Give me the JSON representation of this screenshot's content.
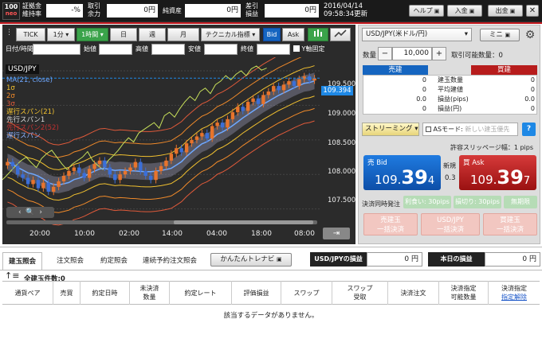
{
  "header": {
    "logo_top": "100",
    "logo_bottom": "neo",
    "margin_label_1": "証拠金",
    "margin_label_2": "維持率",
    "margin_value": "-%",
    "available_label_1": "取引",
    "available_label_2": "余力",
    "available_value": "0円",
    "net_assets_label": "純資産",
    "net_assets_value": "0円",
    "pnl_label_1": "差引",
    "pnl_label_2": "損益",
    "pnl_value": "0円",
    "date": "2016/04/14",
    "time_updated": "09:58:34更新",
    "help_label": "ヘルプ",
    "deposit_label": "入金",
    "withdraw_label": "出金"
  },
  "chart_toolbar": {
    "tick_label": "TICK",
    "interval_1m": "1分",
    "interval_1h": "1時間",
    "day_label": "日",
    "week_label": "週",
    "month_label": "月",
    "indicator_label": "テクニカル指標",
    "bid_label": "Bid",
    "ask_label": "Ask"
  },
  "ohlc": {
    "datetime_label": "日付/時間",
    "open_label": "始値",
    "high_label": "高値",
    "low_label": "安値",
    "close_label": "終値",
    "yfix_label": "Y軸固定"
  },
  "chart_data": {
    "type": "candlestick",
    "title": "USD/JPY",
    "legend": [
      "MA(21, close)",
      "1σ",
      "2σ",
      "3σ",
      "遅行スパン(21)",
      "先行スパン1",
      "先行スパン2(52)",
      "遅行スパン"
    ],
    "x_ticks": [
      "20:00",
      "10:00",
      "02:00",
      "14:00",
      "04:00",
      "18:00",
      "08:00"
    ],
    "y_ticks": [
      "109.500",
      "109.000",
      "108.500",
      "108.000",
      "107.500"
    ],
    "ylim": [
      107.3,
      109.65
    ],
    "current_price": "109.394",
    "closes": [
      108.18,
      108.12,
      108.0,
      107.95,
      107.86,
      107.92,
      107.8,
      107.88,
      107.75,
      107.82,
      107.9,
      107.98,
      108.05,
      108.1,
      108.02,
      107.95,
      108.08,
      108.15,
      108.2,
      108.1,
      108.0,
      107.92,
      108.0,
      108.05,
      108.1,
      108.18,
      108.05,
      107.98,
      107.92,
      108.05,
      108.12,
      108.2,
      108.3,
      108.38,
      108.32,
      108.45,
      108.5,
      108.55,
      108.6,
      108.52,
      108.7,
      108.75,
      108.68,
      108.8,
      108.9,
      108.98,
      108.92,
      109.05,
      109.1,
      109.02,
      109.15,
      109.2,
      109.28,
      109.22,
      109.3,
      109.35,
      109.28,
      109.38,
      109.42,
      109.36,
      109.39
    ]
  },
  "trade_panel": {
    "pair_select": "USD/JPY(米ドル/円)",
    "mini_label": "ミニ",
    "qty_label": "数量",
    "qty_minus": "−",
    "qty_value": "10,000",
    "qty_plus": "+",
    "tradable_label": "取引可能数量：0",
    "sell_header": "売建",
    "buy_header": "買建",
    "rows": [
      {
        "sell": "0",
        "label": "建玉数量",
        "buy": "0"
      },
      {
        "sell": "0",
        "label": "平均建値",
        "buy": "0"
      },
      {
        "sell": "0.0",
        "label": "損益(pips)",
        "buy": "0.0"
      },
      {
        "sell": "0",
        "label": "損益(円)",
        "buy": "0"
      }
    ],
    "streaming_label": "ストリーミング",
    "as_mode_label": "ASモード:",
    "as_mode_value": "新しい建玉優先",
    "slippage_label": "許容スリッページ幅：1 pips",
    "bid_label": "売 Bid",
    "bid_price_main": "109.",
    "bid_price_big": "39",
    "bid_price_tail": "4",
    "new_label": "新規",
    "spread": "0.3",
    "ask_label": "買 Ask",
    "ask_price_main": "109.",
    "ask_price_big": "39",
    "ask_price_tail": "7",
    "settle_label": "決済同時発注",
    "take_profit": "利食い: 30pips",
    "stop_loss": "損切り: 30pips",
    "unlimited": "無期限",
    "sell_settle_1": "売建玉",
    "sell_settle_2": "一括決済",
    "pair_settle_1": "USD/JPY",
    "pair_settle_2": "一括決済",
    "buy_settle_1": "買建玉",
    "buy_settle_2": "一括決済"
  },
  "bottom": {
    "tabs": [
      "建玉照会",
      "注文照会",
      "約定照会",
      "連続予約注文照会"
    ],
    "simple_button": "かんたんトレナビ",
    "pair_pnl_label": "USD/JPYの損益",
    "pair_pnl_value": "0 円",
    "today_pnl_label": "本日の損益",
    "today_pnl_value": "0 円",
    "total_count": "全建玉件数:0",
    "columns": [
      "通貨ペア",
      "売買",
      "約定日時",
      "未決済\n数量",
      "約定レート",
      "評価損益",
      "スワップ",
      "スワップ\n受取",
      "決済注文",
      "決済指定\n可能数量",
      "決済指定"
    ],
    "cancel_link": "指定解除",
    "empty_message": "該当するデータがありません。"
  },
  "colors": {
    "sell_blue": "#1565c0",
    "buy_red": "#b71c1c",
    "green_btn": "#3aa34a",
    "up_candle": "#e8742c",
    "down_candle": "#3b6fd8"
  }
}
